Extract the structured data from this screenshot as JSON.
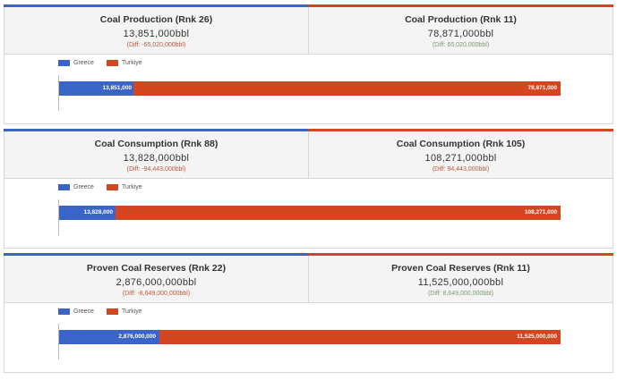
{
  "colors": {
    "greece": "#3b64c8",
    "turkiye": "#d3461f"
  },
  "legend": {
    "greece": "Greece",
    "turkiye": "Turkiye"
  },
  "sections": [
    {
      "left": {
        "title": "Coal Production (Rnk 26)",
        "value": "13,851,000bbl",
        "diff": "(Diff: -65,020,000bbl)"
      },
      "right": {
        "title": "Coal Production (Rnk 11)",
        "value": "78,871,000bbl",
        "diff": "(Diff: 65,020,000bbl)"
      },
      "bars": {
        "greece_label": "13,851,000",
        "turkiye_label": "78,871,000"
      }
    },
    {
      "left": {
        "title": "Coal Consumption (Rnk 88)",
        "value": "13,828,000bbl",
        "diff": "(Diff: -94,443,000bbl)"
      },
      "right": {
        "title": "Coal Consumption (Rnk 105)",
        "value": "108,271,000bbl",
        "diff": "(Diff: 94,443,000bbl)"
      },
      "bars": {
        "greece_label": "13,828,000",
        "turkiye_label": "108,271,000"
      }
    },
    {
      "left": {
        "title": "Proven Coal Reserves (Rnk 22)",
        "value": "2,876,000,000bbl",
        "diff": "(Diff: -8,649,000,000bbl)"
      },
      "right": {
        "title": "Proven Coal Reserves (Rnk 11)",
        "value": "11,525,000,000bbl",
        "diff": "(Diff: 8,649,000,000bbl)"
      },
      "bars": {
        "greece_label": "2,876,000,000",
        "turkiye_label": "11,525,000,000"
      }
    }
  ],
  "chart_data": [
    {
      "type": "bar",
      "orientation": "horizontal",
      "stacked": true,
      "series": [
        {
          "name": "Greece",
          "values": [
            13851000
          ]
        },
        {
          "name": "Turkiye",
          "values": [
            78871000
          ]
        }
      ],
      "legend": "top-left"
    },
    {
      "type": "bar",
      "orientation": "horizontal",
      "stacked": true,
      "series": [
        {
          "name": "Greece",
          "values": [
            13828000
          ]
        },
        {
          "name": "Turkiye",
          "values": [
            108271000
          ]
        }
      ],
      "legend": "top-left"
    },
    {
      "type": "bar",
      "orientation": "horizontal",
      "stacked": true,
      "series": [
        {
          "name": "Greece",
          "values": [
            2876000000
          ]
        },
        {
          "name": "Turkiye",
          "values": [
            11525000000
          ]
        }
      ],
      "legend": "top-left"
    }
  ]
}
